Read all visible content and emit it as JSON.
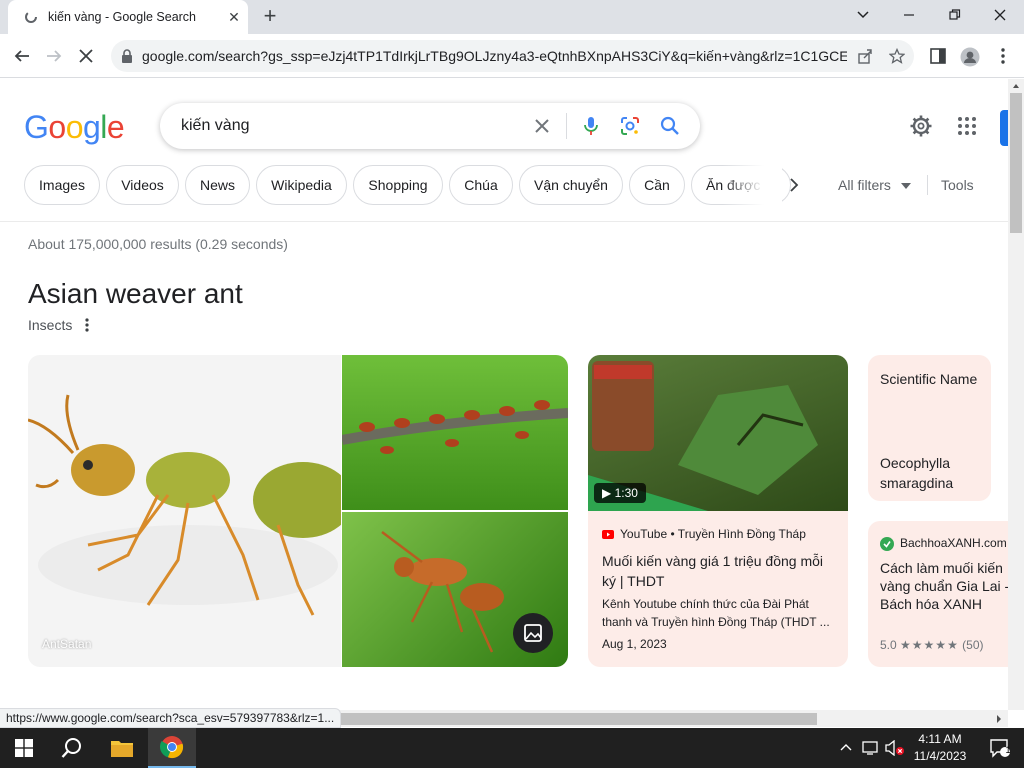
{
  "browser": {
    "tab_title": "kiến vàng - Google Search",
    "url": "google.com/search?gs_ssp=eJzj4tTP1TdIrkjLrTBg9OLJzny4a3-eQtnhBXnpAHS3CiY&q=kiến+vàng&rlz=1C1GCEA..."
  },
  "search": {
    "logo": "Google",
    "query": "kiến vàng",
    "chips": [
      "Images",
      "Videos",
      "News",
      "Wikipedia",
      "Shopping",
      "Chúa",
      "Vận chuyển",
      "Cần",
      "Ăn được"
    ],
    "all_filters": "All filters",
    "tools": "Tools",
    "stats": "About 175,000,000 results (0.29 seconds)"
  },
  "knowledge_panel": {
    "title": "Asian weaver ant",
    "subtitle": "Insects",
    "main_image_caption": "AntSatan",
    "video": {
      "duration": "1:30",
      "source": "YouTube • Truyền Hình Đồng Tháp",
      "title": "Muối kiến vàng giá 1 triệu đồng mỗi ký | THDT",
      "description": "Kênh Youtube chính thức của Đài Phát thanh và Truyền hình Đồng Tháp (THDT ...",
      "date": "Aug 1, 2023"
    },
    "scientific_name": {
      "label": "Scientific Name",
      "value": "Oecophylla smaragdina"
    },
    "recipe": {
      "source": "BachhoaXANH.com",
      "title": "Cách làm muối kiến vàng chuẩn Gia Lai - Bách hóa XANH",
      "rating": "5.0",
      "stars": "★★★★★",
      "count": "(50)"
    }
  },
  "status_bar": {
    "url": "https://www.google.com/search?sca_esv=579397783&rlz=1..."
  },
  "taskbar": {
    "time": "4:11 AM",
    "date": "11/4/2023",
    "notification_count": "1"
  },
  "colors": {
    "google_blue": "#4285f4",
    "google_red": "#ea4335",
    "google_yellow": "#fbbc05",
    "google_green": "#34a853",
    "card_bg": "#fdece8"
  }
}
